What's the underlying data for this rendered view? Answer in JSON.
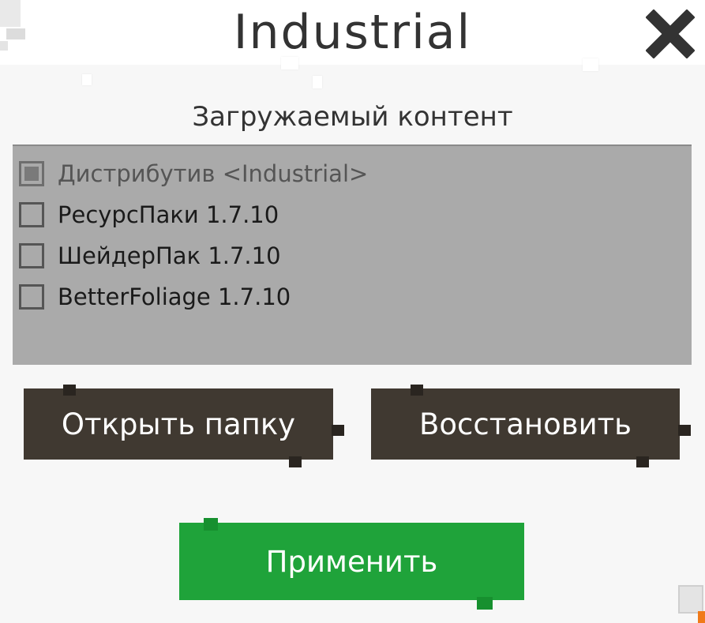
{
  "window": {
    "title": "Industrial",
    "close_icon": "close-icon"
  },
  "content": {
    "section_label": "Загружаемый контент",
    "items": [
      {
        "label": "Дистрибутив <Industrial>",
        "checked": true,
        "locked": true
      },
      {
        "label": "РесурсПаки 1.7.10",
        "checked": false,
        "locked": false
      },
      {
        "label": "ШейдерПак 1.7.10",
        "checked": false,
        "locked": false
      },
      {
        "label": "BetterFoliage 1.7.10",
        "checked": false,
        "locked": false
      }
    ]
  },
  "buttons": {
    "open_folder": "Открыть папку",
    "restore": "Восстановить",
    "apply": "Применить"
  },
  "colors": {
    "dark_button": "#403931",
    "apply_button": "#1fa33a",
    "list_background": "#aaaaaa"
  }
}
